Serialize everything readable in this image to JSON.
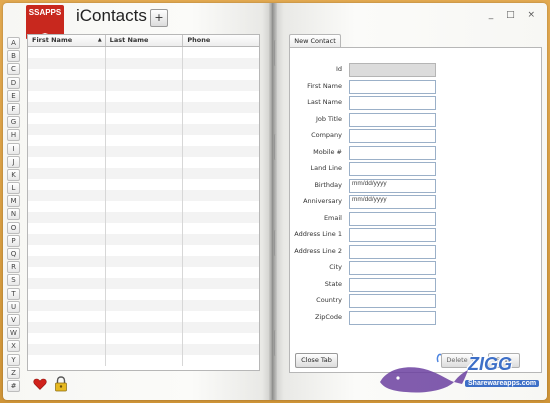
{
  "app": {
    "logo_text": "SSAPPS",
    "title": "iContacts",
    "add_label": "+",
    "window_controls": "_ □ ×"
  },
  "alphabet": [
    "A",
    "B",
    "C",
    "D",
    "E",
    "F",
    "G",
    "H",
    "I",
    "J",
    "K",
    "L",
    "M",
    "N",
    "O",
    "P",
    "Q",
    "R",
    "S",
    "T",
    "U",
    "V",
    "W",
    "X",
    "Y",
    "Z",
    "#"
  ],
  "grid": {
    "columns": [
      "First Name",
      "Last Name",
      "Phone"
    ],
    "sort_indicator": "▲",
    "row_count": 29
  },
  "tabs": [
    "New Contact"
  ],
  "form": {
    "fields": [
      {
        "label": "Id",
        "value": "",
        "placeholder": "",
        "readonly": true
      },
      {
        "label": "First Name",
        "value": "",
        "placeholder": ""
      },
      {
        "label": "Last Name",
        "value": "",
        "placeholder": ""
      },
      {
        "label": "Job Title",
        "value": "",
        "placeholder": ""
      },
      {
        "label": "Company",
        "value": "",
        "placeholder": ""
      },
      {
        "label": "Mobile #",
        "value": "",
        "placeholder": ""
      },
      {
        "label": "Land Line",
        "value": "",
        "placeholder": ""
      },
      {
        "label": "Birthday",
        "value": "mm/dd/yyyy",
        "placeholder": ""
      },
      {
        "label": "Anniversary",
        "value": "mm/dd/yyyy",
        "placeholder": ""
      },
      {
        "label": "Email",
        "value": "",
        "placeholder": ""
      },
      {
        "label": "Address Line 1",
        "value": "",
        "placeholder": ""
      },
      {
        "label": "Address Line 2",
        "value": "",
        "placeholder": ""
      },
      {
        "label": "City",
        "value": "",
        "placeholder": ""
      },
      {
        "label": "State",
        "value": "",
        "placeholder": ""
      },
      {
        "label": "Country",
        "value": "",
        "placeholder": ""
      },
      {
        "label": "ZipCode",
        "value": "",
        "placeholder": ""
      }
    ]
  },
  "buttons": {
    "close_tab": "Close Tab",
    "delete": "Delete",
    "save": "Save"
  },
  "watermark": {
    "brand": "ZIGG",
    "url": "Sharewareapps.com"
  },
  "colors": {
    "background": "#d9a54a",
    "logo_red": "#c8281e",
    "heart_red": "#d0221b",
    "lock_gold": "#e6b820",
    "watermark_blue": "#3d6fc7"
  },
  "icons": {
    "heart": "heart-icon",
    "lock": "lock-icon"
  }
}
